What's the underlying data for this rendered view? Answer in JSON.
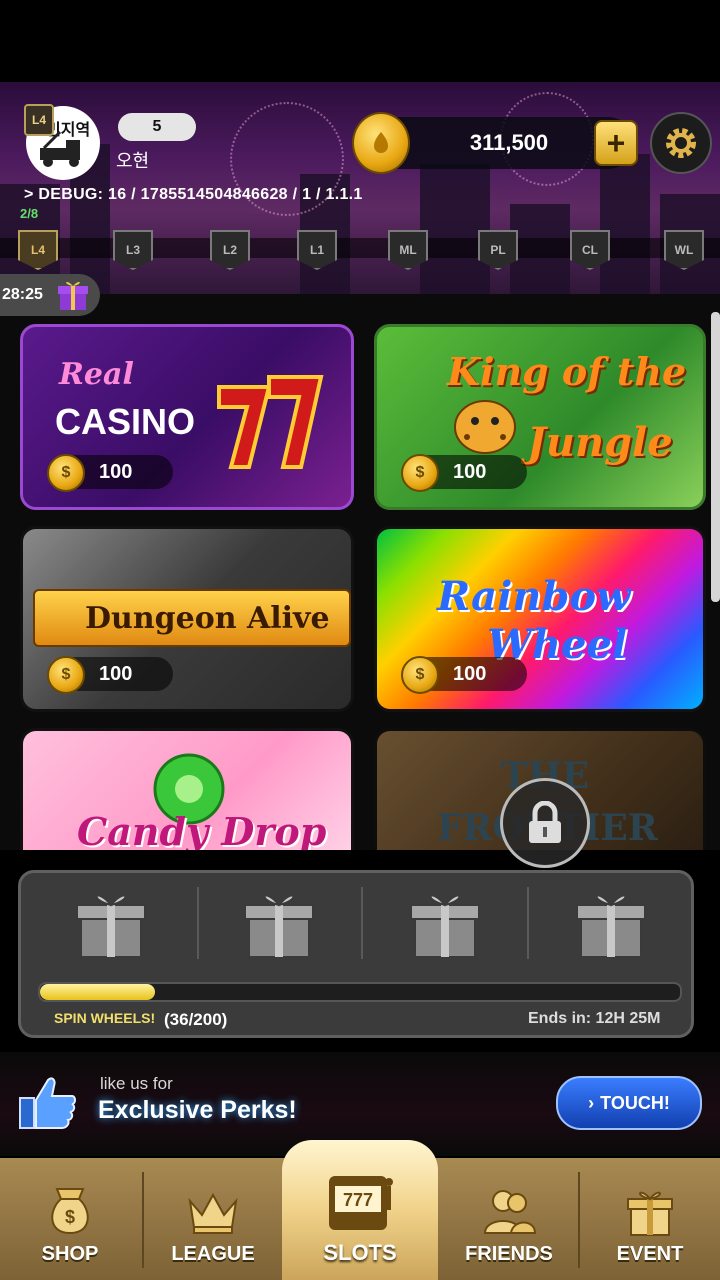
{
  "header": {
    "avatar_text": "민지역",
    "level_badge": "L4",
    "friends_count": "5",
    "user_name": "오현",
    "coins": "311,500",
    "debug": "> DEBUG: 16 / 1785514504846628 / 1 / 1.1.1",
    "progress": "2/8",
    "levels": [
      "L4",
      "L3",
      "L2",
      "L1",
      "ML",
      "PL",
      "CL",
      "WL"
    ],
    "timer": "28:25"
  },
  "games": [
    {
      "title_line1": "Real",
      "title_line2": "CASINO",
      "cost": "100",
      "locked": false
    },
    {
      "title_line1": "King of the",
      "title_line2": "Jungle",
      "cost": "100",
      "locked": false
    },
    {
      "title_line1": "Dungeon Alive",
      "title_line2": "",
      "cost": "100",
      "locked": false
    },
    {
      "title_line1": "Rainbow",
      "title_line2": "Wheel",
      "cost": "100",
      "locked": false
    },
    {
      "title_line1": "Candy Drop",
      "title_line2": "",
      "cost": "",
      "locked": false
    },
    {
      "title_line1": "THE",
      "title_line2": "FRONTIER",
      "cost": "",
      "locked": true
    }
  ],
  "mission": {
    "label": "SPIN WHEELS!",
    "count": "(36/200)",
    "progress": 0.18,
    "ends": "Ends in: 12H 25M"
  },
  "promo": {
    "like_text": "like us for",
    "perks": "Exclusive Perks!",
    "touch": "TOUCH!"
  },
  "nav": {
    "shop": "SHOP",
    "league": "LEAGUE",
    "slots": "SLOTS",
    "friends": "FRIENDS",
    "event": "EVENT"
  }
}
